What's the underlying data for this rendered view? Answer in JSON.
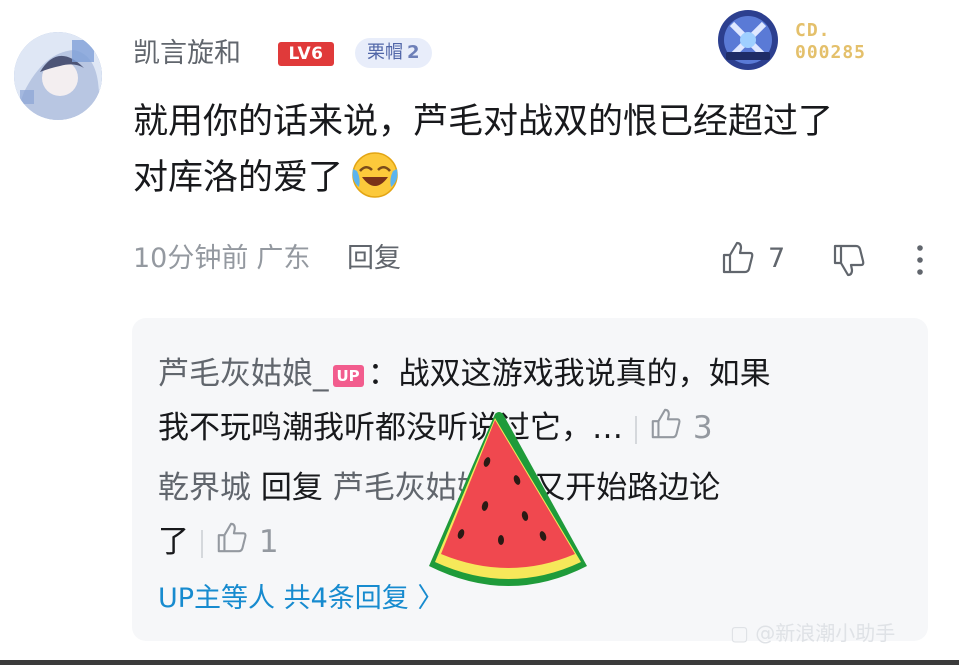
{
  "comment": {
    "username": "凯言旋和",
    "level_badge": "LV6",
    "medal": {
      "label": "栗帽",
      "level": "2"
    },
    "fan_badge": {
      "line1": "CD.",
      "line2": "000285"
    },
    "content_line1": "就用你的话来说，芦毛对战双的恨已经超过了",
    "content_line2": "对库洛的爱了",
    "emoji": "laughing-crying-emoji",
    "time": "10分钟前",
    "location": "广东",
    "reply_label": "回复",
    "like_count": "7"
  },
  "replies": [
    {
      "username": "芦毛灰姑娘_",
      "tag": "UP",
      "text_line1": "：战双这游戏我说真的，如果",
      "text_line2": "我不玩鸣潮我听都没听说过它，…",
      "like_count": "3"
    },
    {
      "username": "乾界城",
      "reply_word": "回复",
      "target_user": "芦毛灰姑娘_",
      "text_line1": "：又开始路边论",
      "text_line2": "了",
      "like_count": "1"
    }
  ],
  "more_replies_label": "UP主等人 共4条回复 〉",
  "overlay_sticker": "watermelon-sticker",
  "colors": {
    "accent_blue": "#178bcf",
    "level_red": "#e03a3a",
    "up_pink": "#f25d8e",
    "panel_bg": "#f6f7f9"
  }
}
